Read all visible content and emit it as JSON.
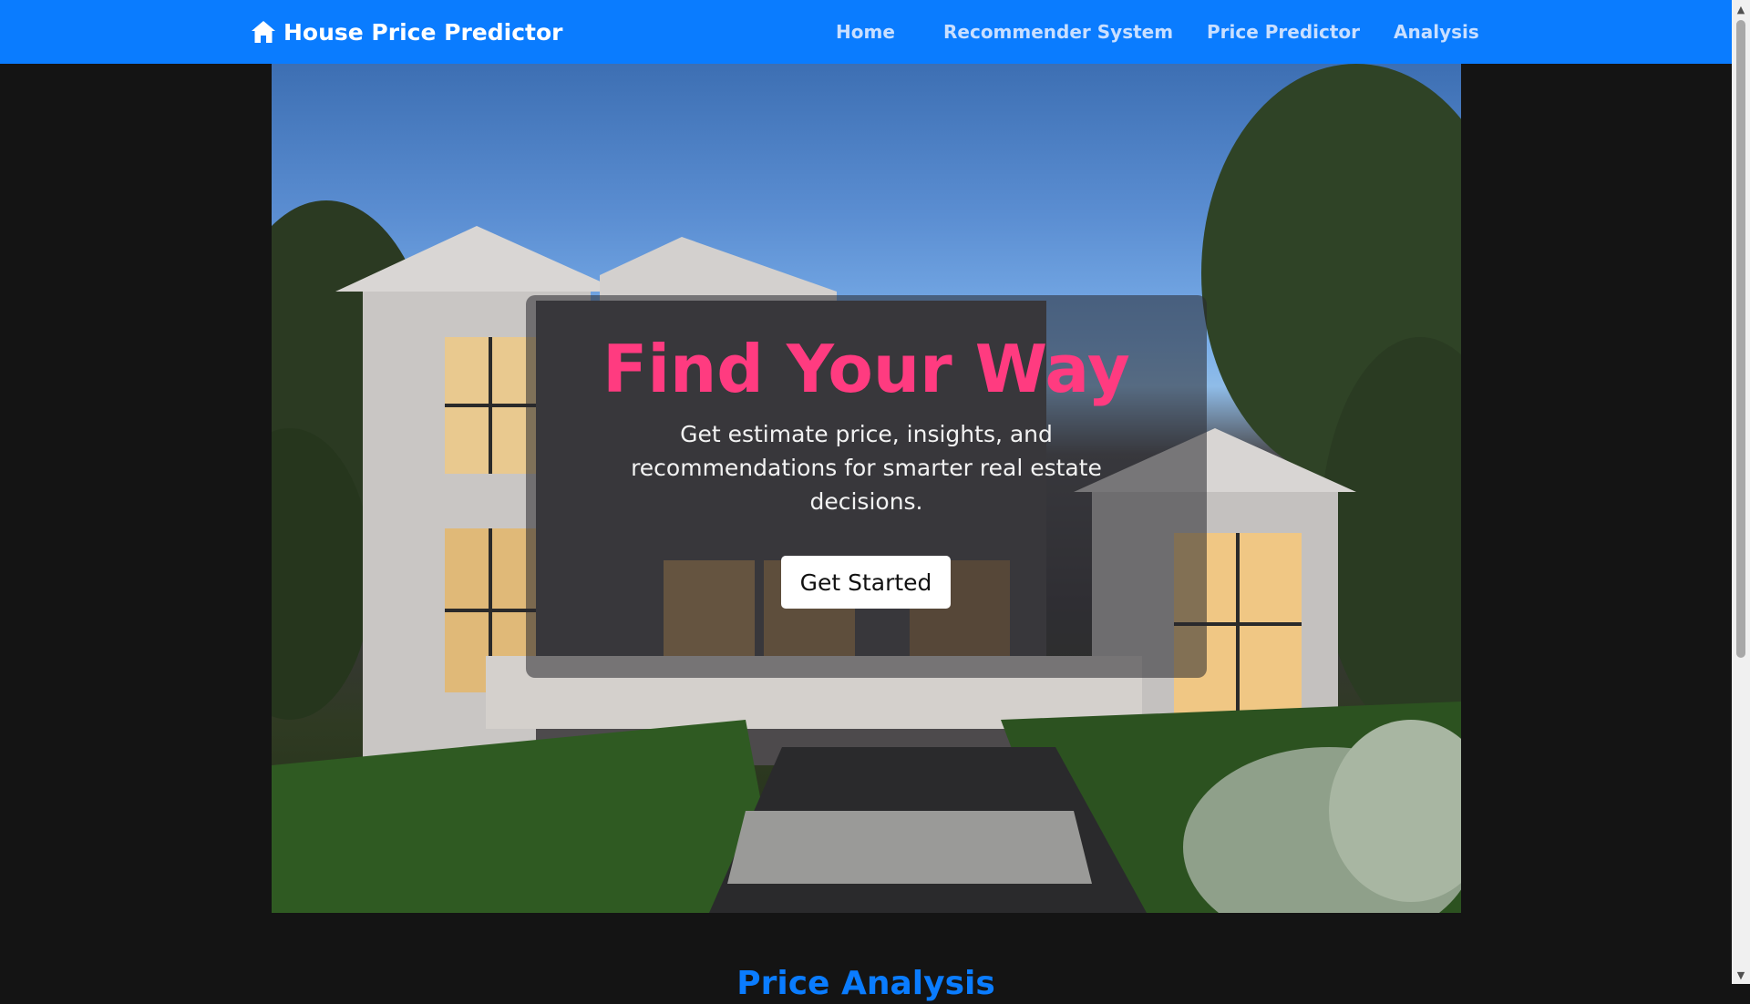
{
  "navbar": {
    "brand_icon": "home-icon",
    "brand_label": "House Price Predictor",
    "links": [
      {
        "label": "Home"
      },
      {
        "label": "Recommender System"
      },
      {
        "label": "Price Predictor"
      },
      {
        "label": "Analysis"
      }
    ],
    "background_color": "#0a7cff"
  },
  "hero": {
    "title": "Find Your Way",
    "subtitle": "Get estimate price, insights, and recommendations for smarter real estate decisions.",
    "cta_label": "Get Started",
    "title_color": "#ff3b80"
  },
  "next_section": {
    "title": "Price Analysis"
  },
  "scrollbar": {
    "up_icon": "chevron-up-icon",
    "down_icon": "chevron-down-icon"
  }
}
